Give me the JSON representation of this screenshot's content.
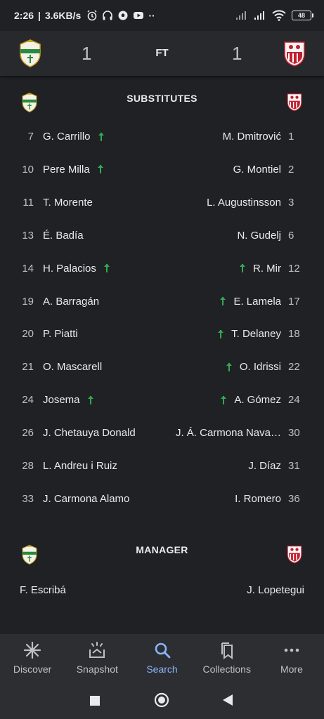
{
  "status_bar": {
    "time": "2:26",
    "speed": "3.6KB/s",
    "battery": "48"
  },
  "match": {
    "home_score": "1",
    "away_score": "1",
    "status": "FT",
    "home_crest": "elche-crest",
    "away_crest": "sevilla-crest"
  },
  "substitutes": {
    "title": "SUBSTITUTES",
    "rows": [
      {
        "home_num": "7",
        "home_name": "G. Carrillo",
        "home_on": true,
        "away_name": "M. Dmitrović",
        "away_num": "1",
        "away_on": false
      },
      {
        "home_num": "10",
        "home_name": "Pere Milla",
        "home_on": true,
        "away_name": "G. Montiel",
        "away_num": "2",
        "away_on": false
      },
      {
        "home_num": "11",
        "home_name": "T. Morente",
        "home_on": false,
        "away_name": "L. Augustinsson",
        "away_num": "3",
        "away_on": false
      },
      {
        "home_num": "13",
        "home_name": "É. Badía",
        "home_on": false,
        "away_name": "N. Gudelj",
        "away_num": "6",
        "away_on": false
      },
      {
        "home_num": "14",
        "home_name": "H. Palacios",
        "home_on": true,
        "away_name": "R. Mir",
        "away_num": "12",
        "away_on": true
      },
      {
        "home_num": "19",
        "home_name": "A. Barragán",
        "home_on": false,
        "away_name": "E. Lamela",
        "away_num": "17",
        "away_on": true
      },
      {
        "home_num": "20",
        "home_name": "P. Piatti",
        "home_on": false,
        "away_name": "T. Delaney",
        "away_num": "18",
        "away_on": true
      },
      {
        "home_num": "21",
        "home_name": "O. Mascarell",
        "home_on": false,
        "away_name": "O. Idrissi",
        "away_num": "22",
        "away_on": true
      },
      {
        "home_num": "24",
        "home_name": "Josema",
        "home_on": true,
        "away_name": "A. Gómez",
        "away_num": "24",
        "away_on": true
      },
      {
        "home_num": "26",
        "home_name": "J. Chetauya Donald",
        "home_on": false,
        "away_name": "J. Á. Carmona Nava…",
        "away_num": "30",
        "away_on": false
      },
      {
        "home_num": "28",
        "home_name": "L. Andreu i Ruiz",
        "home_on": false,
        "away_name": "J. Díaz",
        "away_num": "31",
        "away_on": false
      },
      {
        "home_num": "33",
        "home_name": "J. Carmona Alamo",
        "home_on": false,
        "away_name": "I. Romero",
        "away_num": "36",
        "away_on": false
      }
    ]
  },
  "manager": {
    "title": "MANAGER",
    "home": "F. Escribá",
    "away": "J. Lopetegui"
  },
  "bottom_nav": {
    "items": [
      {
        "label": "Discover",
        "icon": "asterisk-icon",
        "active": false
      },
      {
        "label": "Snapshot",
        "icon": "snapshot-icon",
        "active": false
      },
      {
        "label": "Search",
        "icon": "search-icon",
        "active": true
      },
      {
        "label": "Collections",
        "icon": "collections-icon",
        "active": false
      },
      {
        "label": "More",
        "icon": "more-dots-icon",
        "active": false
      }
    ]
  },
  "colors": {
    "background": "#202124",
    "header": "#28292c",
    "sub_arrow": "#34a853",
    "active_nav": "#8ab4f8"
  }
}
